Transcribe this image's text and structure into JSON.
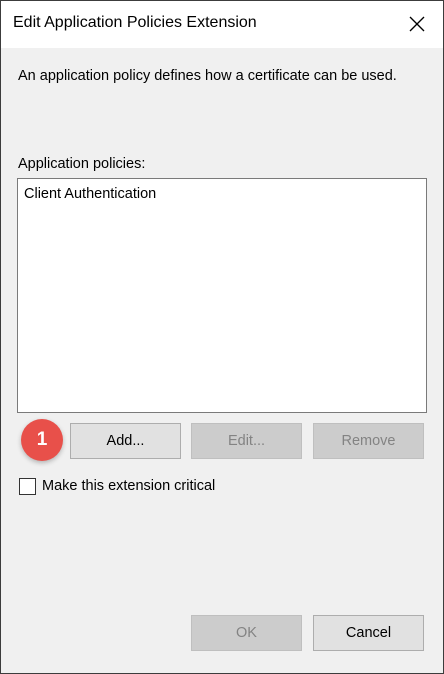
{
  "dialog": {
    "title": "Edit Application Policies Extension",
    "close_icon": "close-icon"
  },
  "description": "An application policy defines how a certificate can be used.",
  "policies": {
    "label": "Application policies:",
    "items": [
      "Client Authentication"
    ]
  },
  "buttons": {
    "add": "Add...",
    "edit": "Edit...",
    "remove": "Remove",
    "ok": "OK",
    "cancel": "Cancel"
  },
  "callout": {
    "number": "1",
    "color": "#e8504a"
  },
  "critical_checkbox": {
    "label": "Make this extension critical",
    "checked": false
  }
}
